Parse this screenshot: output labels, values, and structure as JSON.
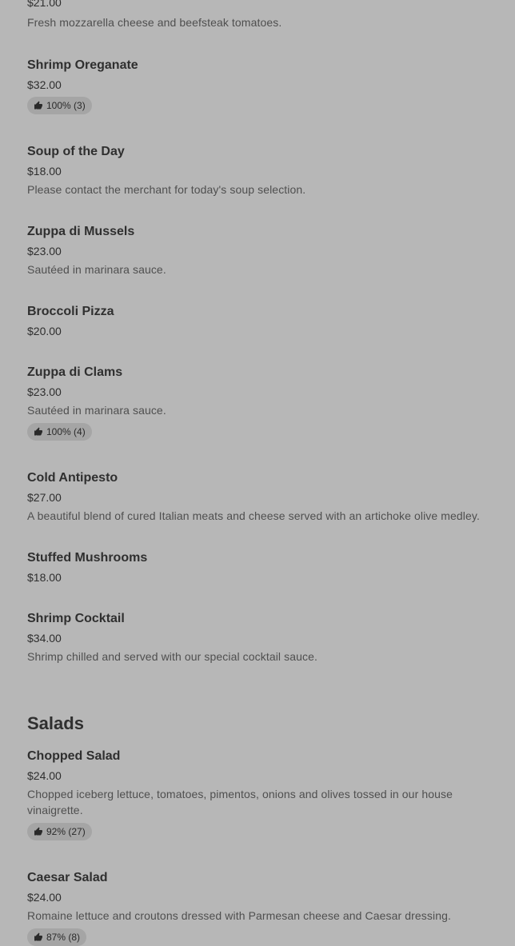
{
  "menu": {
    "items": [
      {
        "price": "$21.00",
        "desc": "Fresh mozzarella cheese and beefsteak tomatoes."
      },
      {
        "name": "Shrimp Oreganate",
        "price": "$32.00",
        "badge": "100% (3)"
      },
      {
        "name": "Soup of the Day",
        "price": "$18.00",
        "desc": "Please contact the merchant for today's soup selection."
      },
      {
        "name": "Zuppa di Mussels",
        "price": "$23.00",
        "desc": "Sautéed in marinara sauce."
      },
      {
        "name": "Broccoli Pizza",
        "price": "$20.00"
      },
      {
        "name": "Zuppa di Clams",
        "price": "$23.00",
        "desc": "Sautéed in marinara sauce.",
        "badge": "100% (4)"
      },
      {
        "name": "Cold Antipesto",
        "price": "$27.00",
        "desc": "A beautiful blend of cured Italian meats and cheese served with an artichoke olive medley."
      },
      {
        "name": "Stuffed Mushrooms",
        "price": "$18.00"
      },
      {
        "name": "Shrimp Cocktail",
        "price": "$34.00",
        "desc": "Shrimp chilled and served with our special cocktail sauce."
      }
    ]
  },
  "salads": {
    "title": "Salads",
    "items": [
      {
        "name": "Chopped Salad",
        "price": "$24.00",
        "desc": "Chopped iceberg lettuce, tomatoes, pimentos, onions and olives tossed in our house vinaigrette.",
        "badge": "92% (27)"
      },
      {
        "name": "Caesar Salad",
        "price": "$24.00",
        "desc": "Romaine lettuce and croutons dressed with Parmesan cheese and Caesar dressing.",
        "badge": "87% (8)"
      }
    ]
  },
  "icons": {
    "thumb": "thumbs-up-icon"
  }
}
